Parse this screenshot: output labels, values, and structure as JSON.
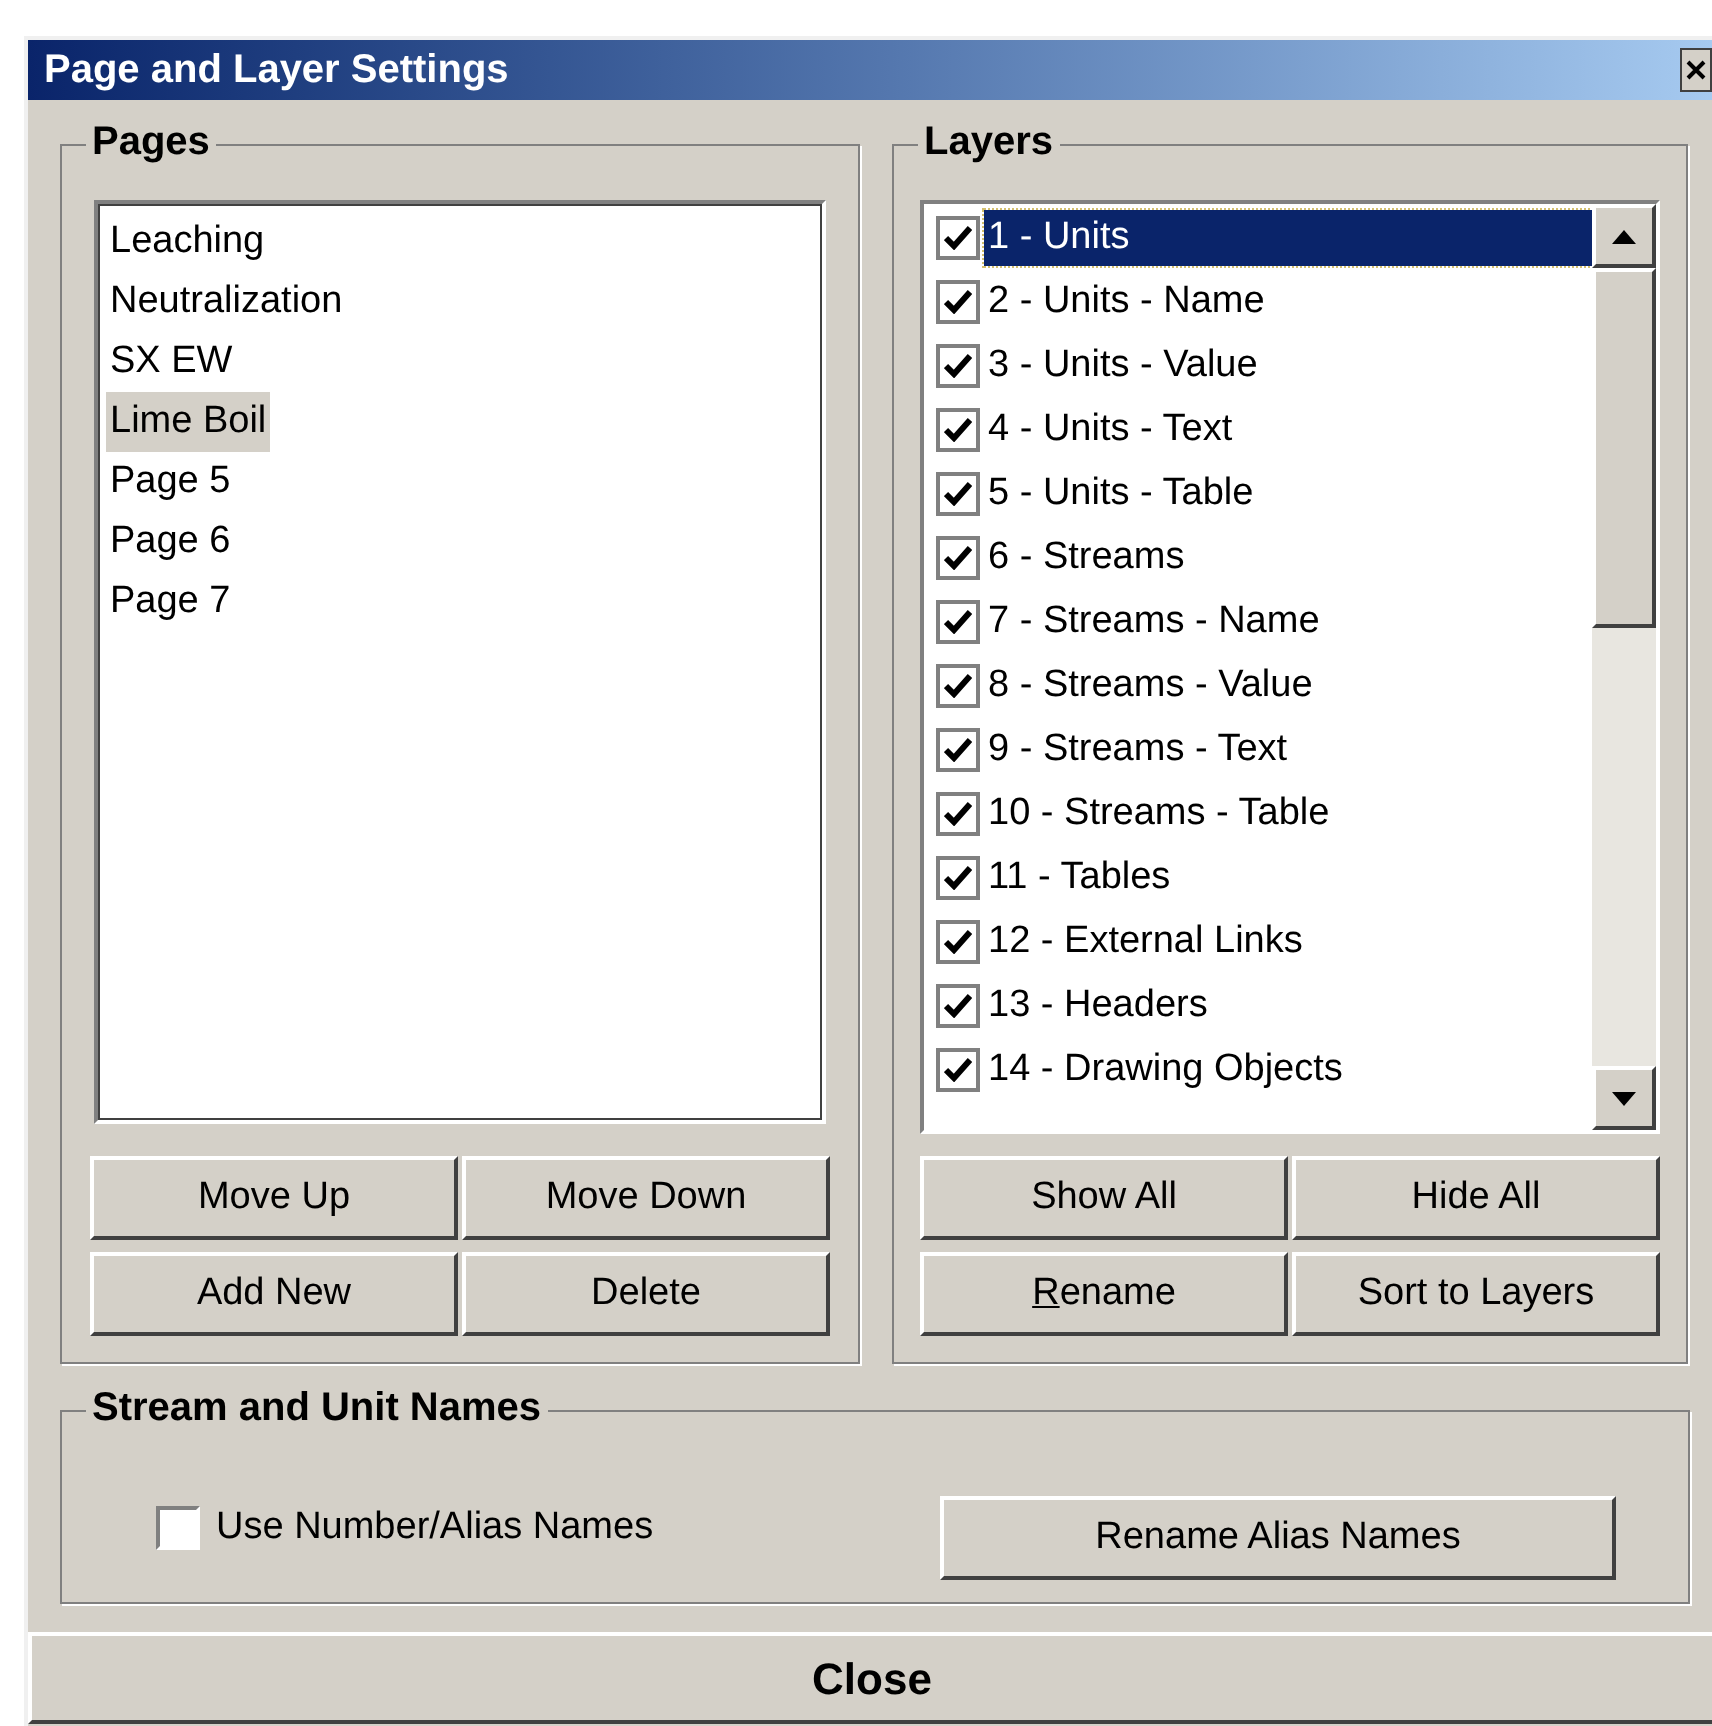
{
  "window": {
    "title": "Page and Layer Settings"
  },
  "pages": {
    "label": "Pages",
    "items": [
      {
        "label": "Leaching",
        "selected": false
      },
      {
        "label": "Neutralization",
        "selected": false
      },
      {
        "label": "SX EW",
        "selected": false
      },
      {
        "label": "Lime Boil",
        "selected": true
      },
      {
        "label": "Page 5",
        "selected": false
      },
      {
        "label": "Page 6",
        "selected": false
      },
      {
        "label": "Page 7",
        "selected": false
      }
    ],
    "buttons": [
      {
        "label": "Move Up"
      },
      {
        "label": "Move Down"
      },
      {
        "label": "Add New"
      },
      {
        "label": "Delete"
      }
    ]
  },
  "layers": {
    "label": "Layers",
    "items": [
      {
        "label": "1 - Units",
        "checked": true,
        "selected": true
      },
      {
        "label": "2 - Units - Name",
        "checked": true,
        "selected": false
      },
      {
        "label": "3 - Units - Value",
        "checked": true,
        "selected": false
      },
      {
        "label": "4 - Units - Text",
        "checked": true,
        "selected": false
      },
      {
        "label": "5 - Units - Table",
        "checked": true,
        "selected": false
      },
      {
        "label": "6 - Streams",
        "checked": true,
        "selected": false
      },
      {
        "label": "7 - Streams - Name",
        "checked": true,
        "selected": false
      },
      {
        "label": "8 - Streams - Value",
        "checked": true,
        "selected": false
      },
      {
        "label": "9 - Streams - Text",
        "checked": true,
        "selected": false
      },
      {
        "label": "10 - Streams - Table",
        "checked": true,
        "selected": false
      },
      {
        "label": "11 - Tables",
        "checked": true,
        "selected": false
      },
      {
        "label": "12 - External Links",
        "checked": true,
        "selected": false
      },
      {
        "label": "13 - Headers",
        "checked": true,
        "selected": false
      },
      {
        "label": "14 - Drawing Objects",
        "checked": true,
        "selected": false
      }
    ],
    "buttons": [
      {
        "label": "Show All",
        "underline_first": false
      },
      {
        "label": "Hide All",
        "underline_first": false
      },
      {
        "label": "Rename",
        "underline_first": true
      },
      {
        "label": "Sort to Layers",
        "underline_first": false
      }
    ]
  },
  "names": {
    "label": "Stream and Unit Names",
    "checkbox": {
      "label": "Use Number/Alias Names",
      "checked": false
    },
    "button": {
      "label": "Rename Alias Names"
    }
  },
  "close_button": {
    "label": "Close"
  }
}
